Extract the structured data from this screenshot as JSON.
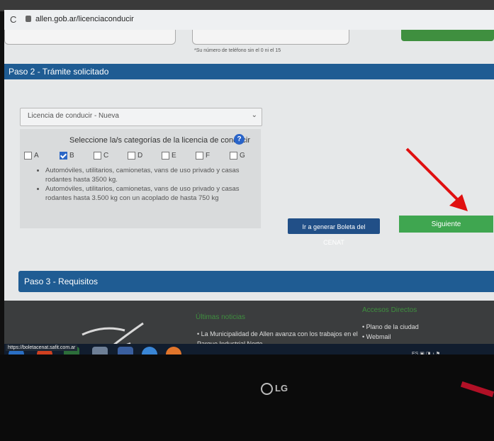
{
  "browser": {
    "url": "allen.gob.ar/licenciaconducir"
  },
  "top_form": {
    "phone_hint": "*Su número de teléfono sin el 0 ni el 15"
  },
  "paso2": {
    "title": "Paso 2 - Trámite solicitado",
    "license_select": "Licencia de conducir - Nueva",
    "categories_heading": "Seleccione la/s categorías de la licencia de conducir",
    "categories": [
      {
        "label": "A",
        "checked": false
      },
      {
        "label": "B",
        "checked": true
      },
      {
        "label": "C",
        "checked": false
      },
      {
        "label": "D",
        "checked": false
      },
      {
        "label": "E",
        "checked": false
      },
      {
        "label": "F",
        "checked": false
      },
      {
        "label": "G",
        "checked": false
      }
    ],
    "descriptions": [
      "Automóviles, utilitarios, camionetas, vans de uso privado y casas rodantes hasta 3500 kg.",
      "Automóviles, utilitarios, camionetas, vans de uso privado y casas rodantes hasta 3.500 kg con un acoplado de hasta 750 kg"
    ],
    "cenat_button": "Ir a generar Boleta del CENAT",
    "next_button": "Siguiente"
  },
  "paso3": {
    "title": "Paso 3 - Requisitos"
  },
  "footer": {
    "news_title": "Últimas noticias",
    "news_item": "La Municipalidad de Allen avanza con los trabajos en el Parque Industrial Norte",
    "links_title": "Accesos Directos",
    "links": [
      "Plano de la ciudad",
      "Webmail"
    ]
  },
  "status_url": "https://boletacenat.safit.com.ar",
  "monitor": {
    "brand": "LG"
  },
  "colors": {
    "section_blue": "#1f5c93",
    "green": "#3fa650",
    "arrow_red": "#e01010"
  },
  "icons": [
    "reload-icon",
    "lock-icon",
    "help-icon",
    "arrow-annotation"
  ]
}
